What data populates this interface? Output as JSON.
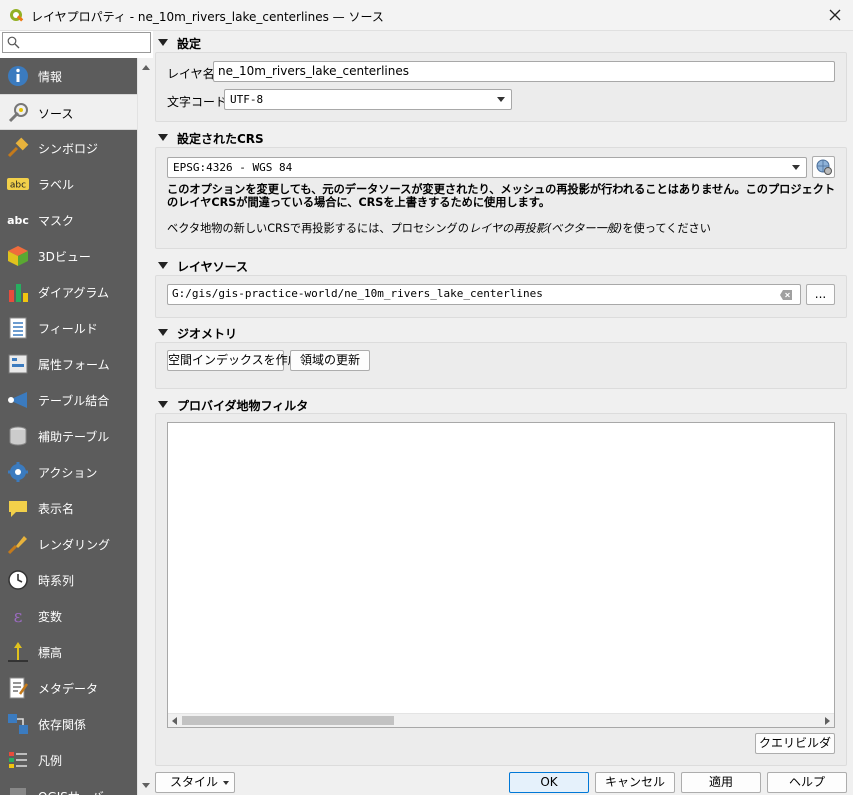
{
  "window": {
    "title": "レイヤプロパティ - ne_10m_rivers_lake_centerlines — ソース"
  },
  "sidebar": {
    "search_placeholder": "",
    "items": [
      {
        "label": "情報",
        "icon": "info-icon"
      },
      {
        "label": "ソース",
        "icon": "source-settings-icon",
        "active": true
      },
      {
        "label": "シンボロジ",
        "icon": "symbology-paintbrush-icon"
      },
      {
        "label": "ラベル",
        "icon": "labels-abc-icon"
      },
      {
        "label": "マスク",
        "icon": "mask-abc-icon"
      },
      {
        "label": "3Dビュー",
        "icon": "3d-cube-icon"
      },
      {
        "label": "ダイアグラム",
        "icon": "diagram-icon"
      },
      {
        "label": "フィールド",
        "icon": "fields-icon"
      },
      {
        "label": "属性フォーム",
        "icon": "attribute-form-icon"
      },
      {
        "label": "テーブル結合",
        "icon": "join-icon"
      },
      {
        "label": "補助テーブル",
        "icon": "auxiliary-storage-icon"
      },
      {
        "label": "アクション",
        "icon": "actions-gear-icon"
      },
      {
        "label": "表示名",
        "icon": "display-speech-bubble-icon"
      },
      {
        "label": "レンダリング",
        "icon": "rendering-brush-icon"
      },
      {
        "label": "時系列",
        "icon": "temporal-clock-icon"
      },
      {
        "label": "変数",
        "icon": "variables-epsilon-icon"
      },
      {
        "label": "標高",
        "icon": "elevation-icon"
      },
      {
        "label": "メタデータ",
        "icon": "metadata-icon"
      },
      {
        "label": "依存関係",
        "icon": "dependencies-icon"
      },
      {
        "label": "凡例",
        "icon": "legend-icon"
      },
      {
        "label": "QGISサーバ",
        "icon": "qgis-server-icon"
      }
    ]
  },
  "settings": {
    "header": "設定",
    "layer_name_label": "レイヤ名",
    "layer_name_value": "ne_10m_rivers_lake_centerlines",
    "encoding_label": "文字コード",
    "encoding_value": "UTF-8"
  },
  "crs": {
    "header": "設定されたCRS",
    "value": "EPSG:4326 - WGS 84",
    "warning": "このオプションを変更しても、元のデータソースが変更されたり、メッシュの再投影が行われることはありません。このプロジェクトのレイヤCRSが間違っている場合に、CRSを上書きするために使用します。",
    "hint_prefix": "ベクタ地物の新しいCRSで再投影するには、プロセシングの",
    "hint_italic": "レイヤの再投影(ベクター一般)",
    "hint_suffix": "を使ってください"
  },
  "layer_source": {
    "header": "レイヤソース",
    "path": "G:/gis/gis-practice-world/ne_10m_rivers_lake_centerlines",
    "browse_label": "..."
  },
  "geometry": {
    "header": "ジオメトリ",
    "spatial_index_label": "空間インデックスを作成",
    "update_extent_label": "領域の更新"
  },
  "filter": {
    "header": "プロバイダ地物フィルタ",
    "expression": "",
    "query_builder_label": "クエリビルダ"
  },
  "footer": {
    "style_label": "スタイル",
    "ok_label": "OK",
    "cancel_label": "キャンセル",
    "apply_label": "適用",
    "help_label": "ヘルプ"
  }
}
